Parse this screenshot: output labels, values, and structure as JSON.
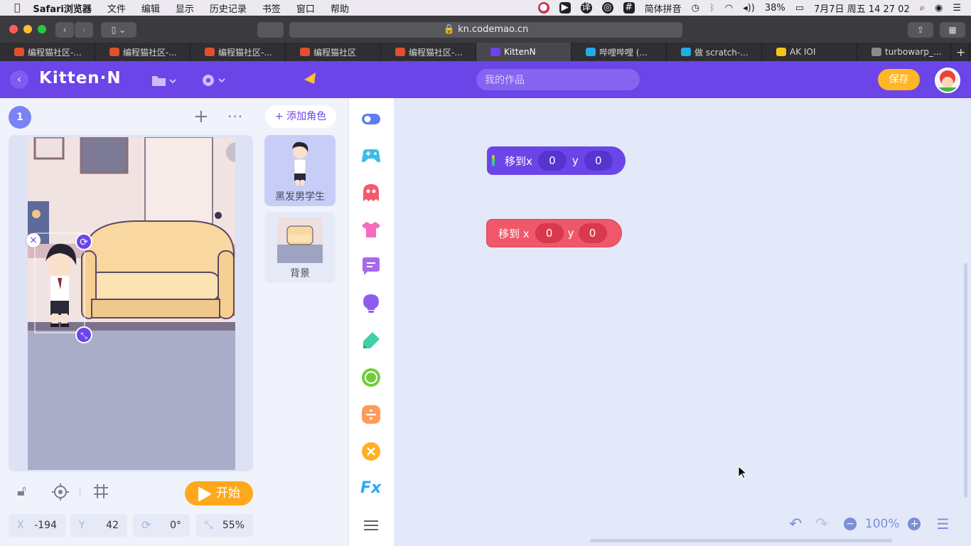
{
  "menubar": {
    "app_name": "Safari浏览器",
    "items": [
      "文件",
      "编辑",
      "显示",
      "历史记录",
      "书签",
      "窗口",
      "帮助"
    ],
    "input_method": "简体拼音",
    "battery": "38%",
    "datetime": "7月7日 周五  14 27 02"
  },
  "browser": {
    "url": "kn.codemao.cn",
    "tabs": [
      {
        "label": "编程猫社区-...",
        "active": false,
        "fav_color": "#e0502d"
      },
      {
        "label": "编程猫社区-...",
        "active": false,
        "fav_color": "#e0502d"
      },
      {
        "label": "编程猫社区-...",
        "active": false,
        "fav_color": "#e0502d"
      },
      {
        "label": "编程猫社区",
        "active": false,
        "fav_color": "#e0502d"
      },
      {
        "label": "编程猫社区-...",
        "active": false,
        "fav_color": "#e0502d"
      },
      {
        "label": "KittenN",
        "active": true,
        "fav_color": "#6b45e8"
      },
      {
        "label": "哔哩哔哩 (...",
        "active": false,
        "fav_color": "#23ade5"
      },
      {
        "label": "做 scratch-...",
        "active": false,
        "fav_color": "#23ade5"
      },
      {
        "label": "AK IOI",
        "active": false,
        "fav_color": "#f5c518"
      },
      {
        "label": "turbowarp_...",
        "active": false,
        "fav_color": "#8a8a8a"
      }
    ],
    "new_tab_label": "+"
  },
  "app": {
    "logo": "Kitten·N",
    "search_placeholder": "我的作品",
    "save_label": "保存",
    "brand_color": "#6b45e8"
  },
  "stage": {
    "scene_number": "1",
    "start_label": "开始",
    "x_label": "X",
    "x_value": "-194",
    "y_label": "Y",
    "y_value": "42",
    "rotation_value": "0°",
    "scale_value": "55%"
  },
  "sprites": {
    "add_label": "+ 添加角色",
    "items": [
      {
        "name": "黑发男学生",
        "selected": true
      },
      {
        "name": "背景",
        "selected": false
      }
    ]
  },
  "categories": [
    {
      "icon": "toggle-icon",
      "color": "#5f7cf0"
    },
    {
      "icon": "gamepad-icon",
      "color": "#3cbde8"
    },
    {
      "icon": "ghost-icon",
      "color": "#f55a6b"
    },
    {
      "icon": "shirt-icon",
      "color": "#f46cbd"
    },
    {
      "icon": "speech-bubble-icon",
      "color": "#a768f0"
    },
    {
      "icon": "bulb-icon",
      "color": "#8f5cf0"
    },
    {
      "icon": "pen-icon",
      "color": "#3fd0a7"
    },
    {
      "icon": "circle-icon",
      "color": "#6fcf3a"
    },
    {
      "icon": "divide-icon",
      "color": "#ff9a5a"
    },
    {
      "icon": "cross-icon",
      "color": "#ffb022"
    },
    {
      "icon": "fx-icon",
      "color": "#2ea8f5"
    },
    {
      "icon": "menu-icon",
      "color": "#5a6170"
    }
  ],
  "blocks": [
    {
      "label": "移到x",
      "x": "0",
      "y_label": "y",
      "y": "0",
      "color": "#6b45e8",
      "pill_color": "#5534d0"
    },
    {
      "label": "移到 x",
      "x": "0",
      "y_label": "y",
      "y": "0",
      "color": "#f0576a",
      "pill_color": "#d8394d"
    }
  ],
  "zoom": {
    "value": "100%"
  }
}
